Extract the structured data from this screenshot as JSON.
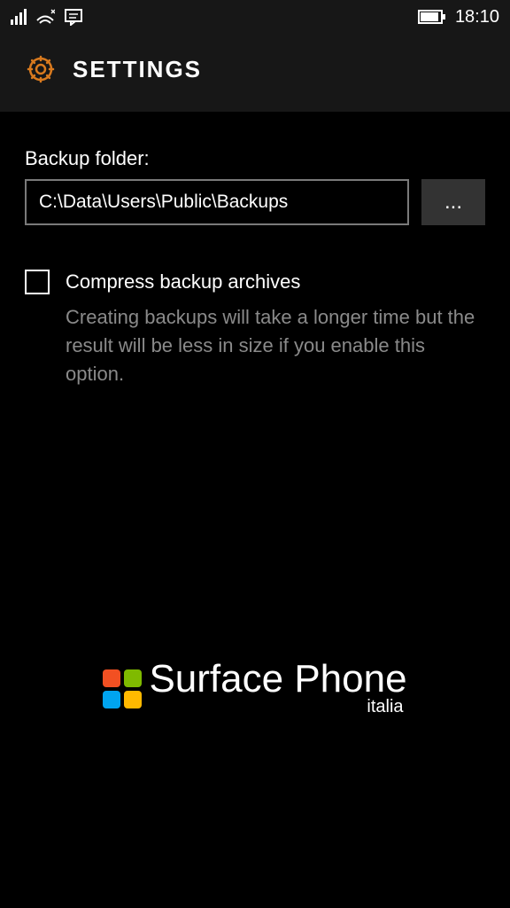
{
  "status": {
    "time": "18:10"
  },
  "header": {
    "title": "SETTINGS"
  },
  "backup": {
    "label": "Backup folder:",
    "path": "C:\\Data\\Users\\Public\\Backups",
    "browse": "..."
  },
  "compress": {
    "label": "Compress backup archives",
    "description": "Creating backups will take a longer time but the result will be less in size if you enable this option."
  },
  "watermark": {
    "main": "Surface Phone",
    "sub": "italia"
  }
}
